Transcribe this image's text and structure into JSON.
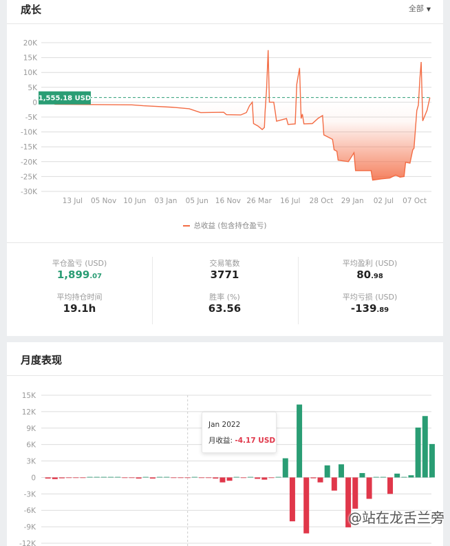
{
  "growth": {
    "title": "成长",
    "filter_label": "全部",
    "legend_label": "总收益 (包含持仓盈亏)",
    "current_label": "1,555.18 USD"
  },
  "stats": [
    {
      "label": "平仓盈亏 (USD)",
      "int": "1,899",
      "dec": ".07",
      "color": "#2a9d74"
    },
    {
      "label": "交易笔数",
      "int": "3771",
      "dec": ""
    },
    {
      "label": "平均盈利 (USD)",
      "int": "80",
      "dec": ".98"
    },
    {
      "label": "平均持仓时间",
      "int": "19.1h",
      "dec": ""
    },
    {
      "label": "胜率 (%)",
      "int": "63.56",
      "dec": ""
    },
    {
      "label": "平均亏损 (USD)",
      "int": "-139",
      "dec": ".89"
    }
  ],
  "monthly": {
    "title": "月度表现",
    "tooltip": {
      "month": "Jan 2022",
      "label": "月收益: ",
      "value": "-4.17 USD"
    }
  },
  "watermark": "@站在龙舌兰旁",
  "colors": {
    "line": "#f36b43",
    "positive": "#2a9d74",
    "negative": "#e0374a"
  },
  "chart_data": [
    {
      "type": "line",
      "title": "",
      "x_axis": "category",
      "x_ticks": [
        "13 Jul",
        "05 Nov",
        "10 Jun",
        "03 Jan",
        "05 Jun",
        "16 Nov",
        "26 Mar",
        "16 Jul",
        "28 Oct",
        "29 Jan",
        "02 Jul",
        "07 Oct"
      ],
      "y_ticks": [
        "20K",
        "15K",
        "10K",
        "5K",
        "0",
        "-5K",
        "-10K",
        "-15K",
        "-20K",
        "-25K",
        "-30K"
      ],
      "ylim": [
        -30000,
        20000
      ],
      "grid": true,
      "legend": "bottom",
      "reference_line": {
        "value": 1555.18,
        "label": "1,555.18 USD"
      },
      "series": [
        {
          "name": "总收益 (包含持仓盈亏)",
          "points": [
            [
              -0.58,
              -700
            ],
            [
              1.91,
              -900
            ],
            [
              2.28,
              -1200
            ],
            [
              3.2,
              -1700
            ],
            [
              3.75,
              -2200
            ],
            [
              4.12,
              -3500
            ],
            [
              4.86,
              -3400
            ],
            [
              4.95,
              -4200
            ],
            [
              5.41,
              -4300
            ],
            [
              5.59,
              -3500
            ],
            [
              5.69,
              -1200
            ],
            [
              5.78,
              0
            ],
            [
              5.82,
              -7200
            ],
            [
              5.96,
              -8000
            ],
            [
              6.1,
              -9200
            ],
            [
              6.17,
              -8500
            ],
            [
              6.19,
              -3500
            ],
            [
              6.24,
              4500
            ],
            [
              6.29,
              17500
            ],
            [
              6.33,
              0
            ],
            [
              6.47,
              0
            ],
            [
              6.52,
              -3400
            ],
            [
              6.56,
              -6400
            ],
            [
              6.88,
              -5500
            ],
            [
              6.93,
              -7500
            ],
            [
              7.16,
              -7300
            ],
            [
              7.21,
              6000
            ],
            [
              7.3,
              11500
            ],
            [
              7.35,
              -5500
            ],
            [
              7.39,
              -4000
            ],
            [
              7.44,
              -7300
            ],
            [
              7.71,
              -7200
            ],
            [
              7.9,
              -5400
            ],
            [
              8.04,
              -4500
            ],
            [
              8.08,
              -11000
            ],
            [
              8.36,
              -12500
            ],
            [
              8.41,
              -16000
            ],
            [
              8.5,
              -16500
            ],
            [
              8.54,
              -19500
            ],
            [
              8.87,
              -20000
            ],
            [
              9.05,
              -17000
            ],
            [
              9.1,
              -23000
            ],
            [
              9.6,
              -23000
            ],
            [
              9.65,
              -26200
            ],
            [
              9.93,
              -25800
            ],
            [
              10.2,
              -25500
            ],
            [
              10.39,
              -24500
            ],
            [
              10.53,
              -25200
            ],
            [
              10.66,
              -25000
            ],
            [
              10.71,
              -20200
            ],
            [
              10.85,
              -20500
            ],
            [
              10.94,
              -16000
            ],
            [
              10.98,
              -15500
            ],
            [
              11.07,
              -2800
            ],
            [
              11.12,
              -1000
            ],
            [
              11.17,
              8000
            ],
            [
              11.21,
              13500
            ],
            [
              11.26,
              -6300
            ],
            [
              11.4,
              -2700
            ],
            [
              11.49,
              1555.18
            ]
          ]
        }
      ]
    },
    {
      "type": "bar",
      "title": "",
      "y_ticks": [
        "15K",
        "12K",
        "9K",
        "6K",
        "3K",
        "0",
        "-3K",
        "-6K",
        "-9K",
        "-12K"
      ],
      "ylim": [
        -12000,
        15000
      ],
      "grid": true,
      "highlight_index": 20,
      "values": [
        -200,
        -300,
        -150,
        -20,
        -30,
        -20,
        0,
        0,
        0,
        0,
        0,
        -20,
        -30,
        -200,
        0,
        -200,
        0,
        0,
        -100,
        -100,
        -4.17,
        0,
        -100,
        -100,
        -200,
        -900,
        -600,
        0,
        -30,
        10,
        -250,
        -400,
        -100,
        0,
        3500,
        -8000,
        13300,
        -10200,
        -150,
        -900,
        2200,
        -2400,
        2400,
        -9100,
        -5700,
        800,
        -3900,
        100,
        100,
        -3000,
        700,
        0,
        400,
        9100,
        11200,
        6100
      ]
    }
  ]
}
